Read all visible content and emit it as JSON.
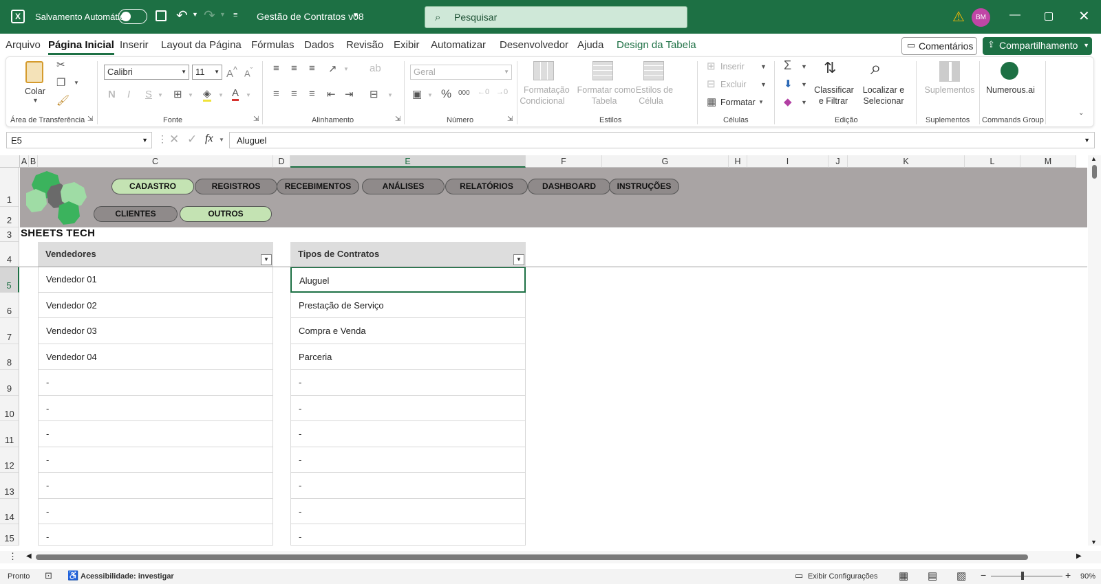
{
  "titlebar": {
    "autosave_label": "Salvamento Automático",
    "doc_title": "Gestão de Contratos v08",
    "search_placeholder": "Pesquisar",
    "user_initials": "BM"
  },
  "menu": {
    "items": [
      "Arquivo",
      "Página Inicial",
      "Inserir",
      "Layout da Página",
      "Fórmulas",
      "Dados",
      "Revisão",
      "Exibir",
      "Automatizar",
      "Desenvolvedor",
      "Ajuda",
      "Design da Tabela"
    ],
    "active": "Página Inicial",
    "comments": "Comentários",
    "share": "Compartilhamento"
  },
  "ribbon": {
    "clipboard": {
      "paste": "Colar",
      "group": "Área de Transferência"
    },
    "font": {
      "name": "Calibri",
      "size": "11",
      "bold": "N",
      "italic": "I",
      "underline": "S",
      "group": "Fonte"
    },
    "alignment": {
      "group": "Alinhamento"
    },
    "number": {
      "format": "Geral",
      "percent": "%",
      "thousands": "000",
      "group": "Número"
    },
    "styles": {
      "conditional_1": "Formatação",
      "conditional_2": "Condicional",
      "as_table_1": "Formatar como",
      "as_table_2": "Tabela",
      "cell_styles_1": "Estilos de",
      "cell_styles_2": "Célula",
      "group": "Estilos"
    },
    "cells": {
      "insert": "Inserir",
      "delete": "Excluir",
      "format": "Formatar",
      "group": "Células"
    },
    "editing": {
      "sort_1": "Classificar",
      "sort_2": "e Filtrar",
      "find_1": "Localizar e",
      "find_2": "Selecionar",
      "group": "Edição"
    },
    "addins": {
      "label": "Suplementos",
      "group": "Suplementos"
    },
    "numerous": {
      "label": "Numerous.ai",
      "group": "Commands Group"
    }
  },
  "formula_bar": {
    "name_box": "E5",
    "formula": "Aluguel",
    "fx": "fx"
  },
  "columns": [
    "A",
    "B",
    "C",
    "D",
    "E",
    "F",
    "G",
    "H",
    "I",
    "J",
    "K",
    "L",
    "M"
  ],
  "selected_column": "E",
  "rows": [
    "1",
    "2",
    "3",
    "4",
    "5",
    "6",
    "7",
    "8",
    "9",
    "10",
    "11",
    "12",
    "13",
    "14",
    "15"
  ],
  "selected_row": "5",
  "nav_buttons": {
    "row1": [
      "CADASTRO",
      "REGISTROS",
      "RECEBIMENTOS",
      "ANÁLISES",
      "RELATÓRIOS",
      "DASHBOARD",
      "INSTRUÇÕES"
    ],
    "row2": [
      "CLIENTES",
      "OUTROS"
    ],
    "highlighted": [
      "CADASTRO",
      "OUTROS"
    ]
  },
  "brand": "SHEETS TECH",
  "tables": {
    "vendedores": {
      "header": "Vendedores",
      "rows": [
        "Vendedor 01",
        "Vendedor 02",
        "Vendedor 03",
        "Vendedor 04",
        "-",
        "-",
        "-",
        "-",
        "-",
        "-",
        "-"
      ]
    },
    "contratos": {
      "header": "Tipos de Contratos",
      "rows": [
        "Aluguel",
        "Prestação de Serviço",
        "Compra e Venda",
        "Parceria",
        "-",
        "-",
        "-",
        "-",
        "-",
        "-",
        "-"
      ]
    }
  },
  "status": {
    "ready": "Pronto",
    "accessibility": "Acessibilidade: investigar",
    "display_settings": "Exibir Configurações",
    "zoom": "90%"
  },
  "colors": {
    "accent": "#1d7044",
    "band": "#a9a4a4",
    "pill_light": "#c4e3b3"
  }
}
